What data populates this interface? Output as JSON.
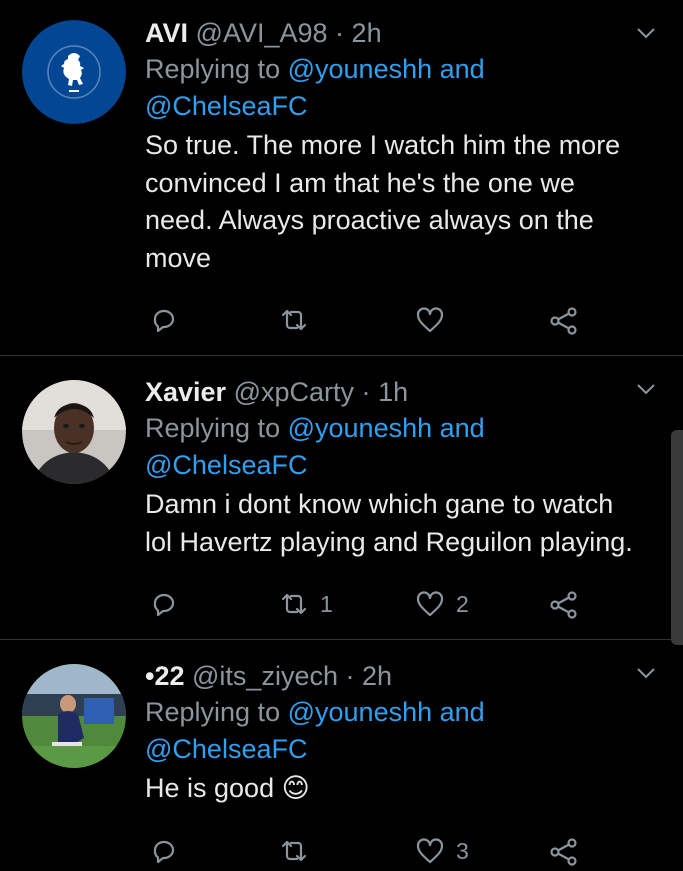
{
  "tweets": [
    {
      "name": "AVI",
      "handle": "@AVI_A98",
      "time": "2h",
      "avatar": "chelsea-lion-crest",
      "avatar_color": "#034694",
      "replying_prefix": "Replying to",
      "mention_1": "@youneshh",
      "conj": "and",
      "mention_2": "@ChelseaFC",
      "text_lines": [
        "So true. The more I watch him the more",
        "convinced I am that he's the one we",
        "need. Always proactive always on the",
        "move"
      ],
      "retweets": "",
      "likes": ""
    },
    {
      "name": "Xavier",
      "handle": "@xpCarty",
      "time": "1h",
      "avatar": "user-photo",
      "replying_prefix": "Replying to",
      "mention_1": "@youneshh",
      "conj": "and",
      "mention_2": "@ChelseaFC",
      "text_lines": [
        "Damn i dont know which gane to watch",
        "lol Havertz playing and Reguilon playing."
      ],
      "retweets": "1",
      "likes": "2"
    },
    {
      "name": "•22",
      "handle": "@its_ziyech",
      "time": "2h",
      "avatar": "player-photo",
      "replying_prefix": "Replying to",
      "mention_1": "@youneshh",
      "conj": "and",
      "mention_2": "@ChelseaFC",
      "text_lines": [
        "He is good"
      ],
      "emoji": "😊",
      "retweets": "",
      "likes": "3"
    }
  ],
  "colors": {
    "background": "#000000",
    "mention": "#2fa0f0",
    "secondary_text": "#8b959e",
    "divider": "#2f3336"
  }
}
